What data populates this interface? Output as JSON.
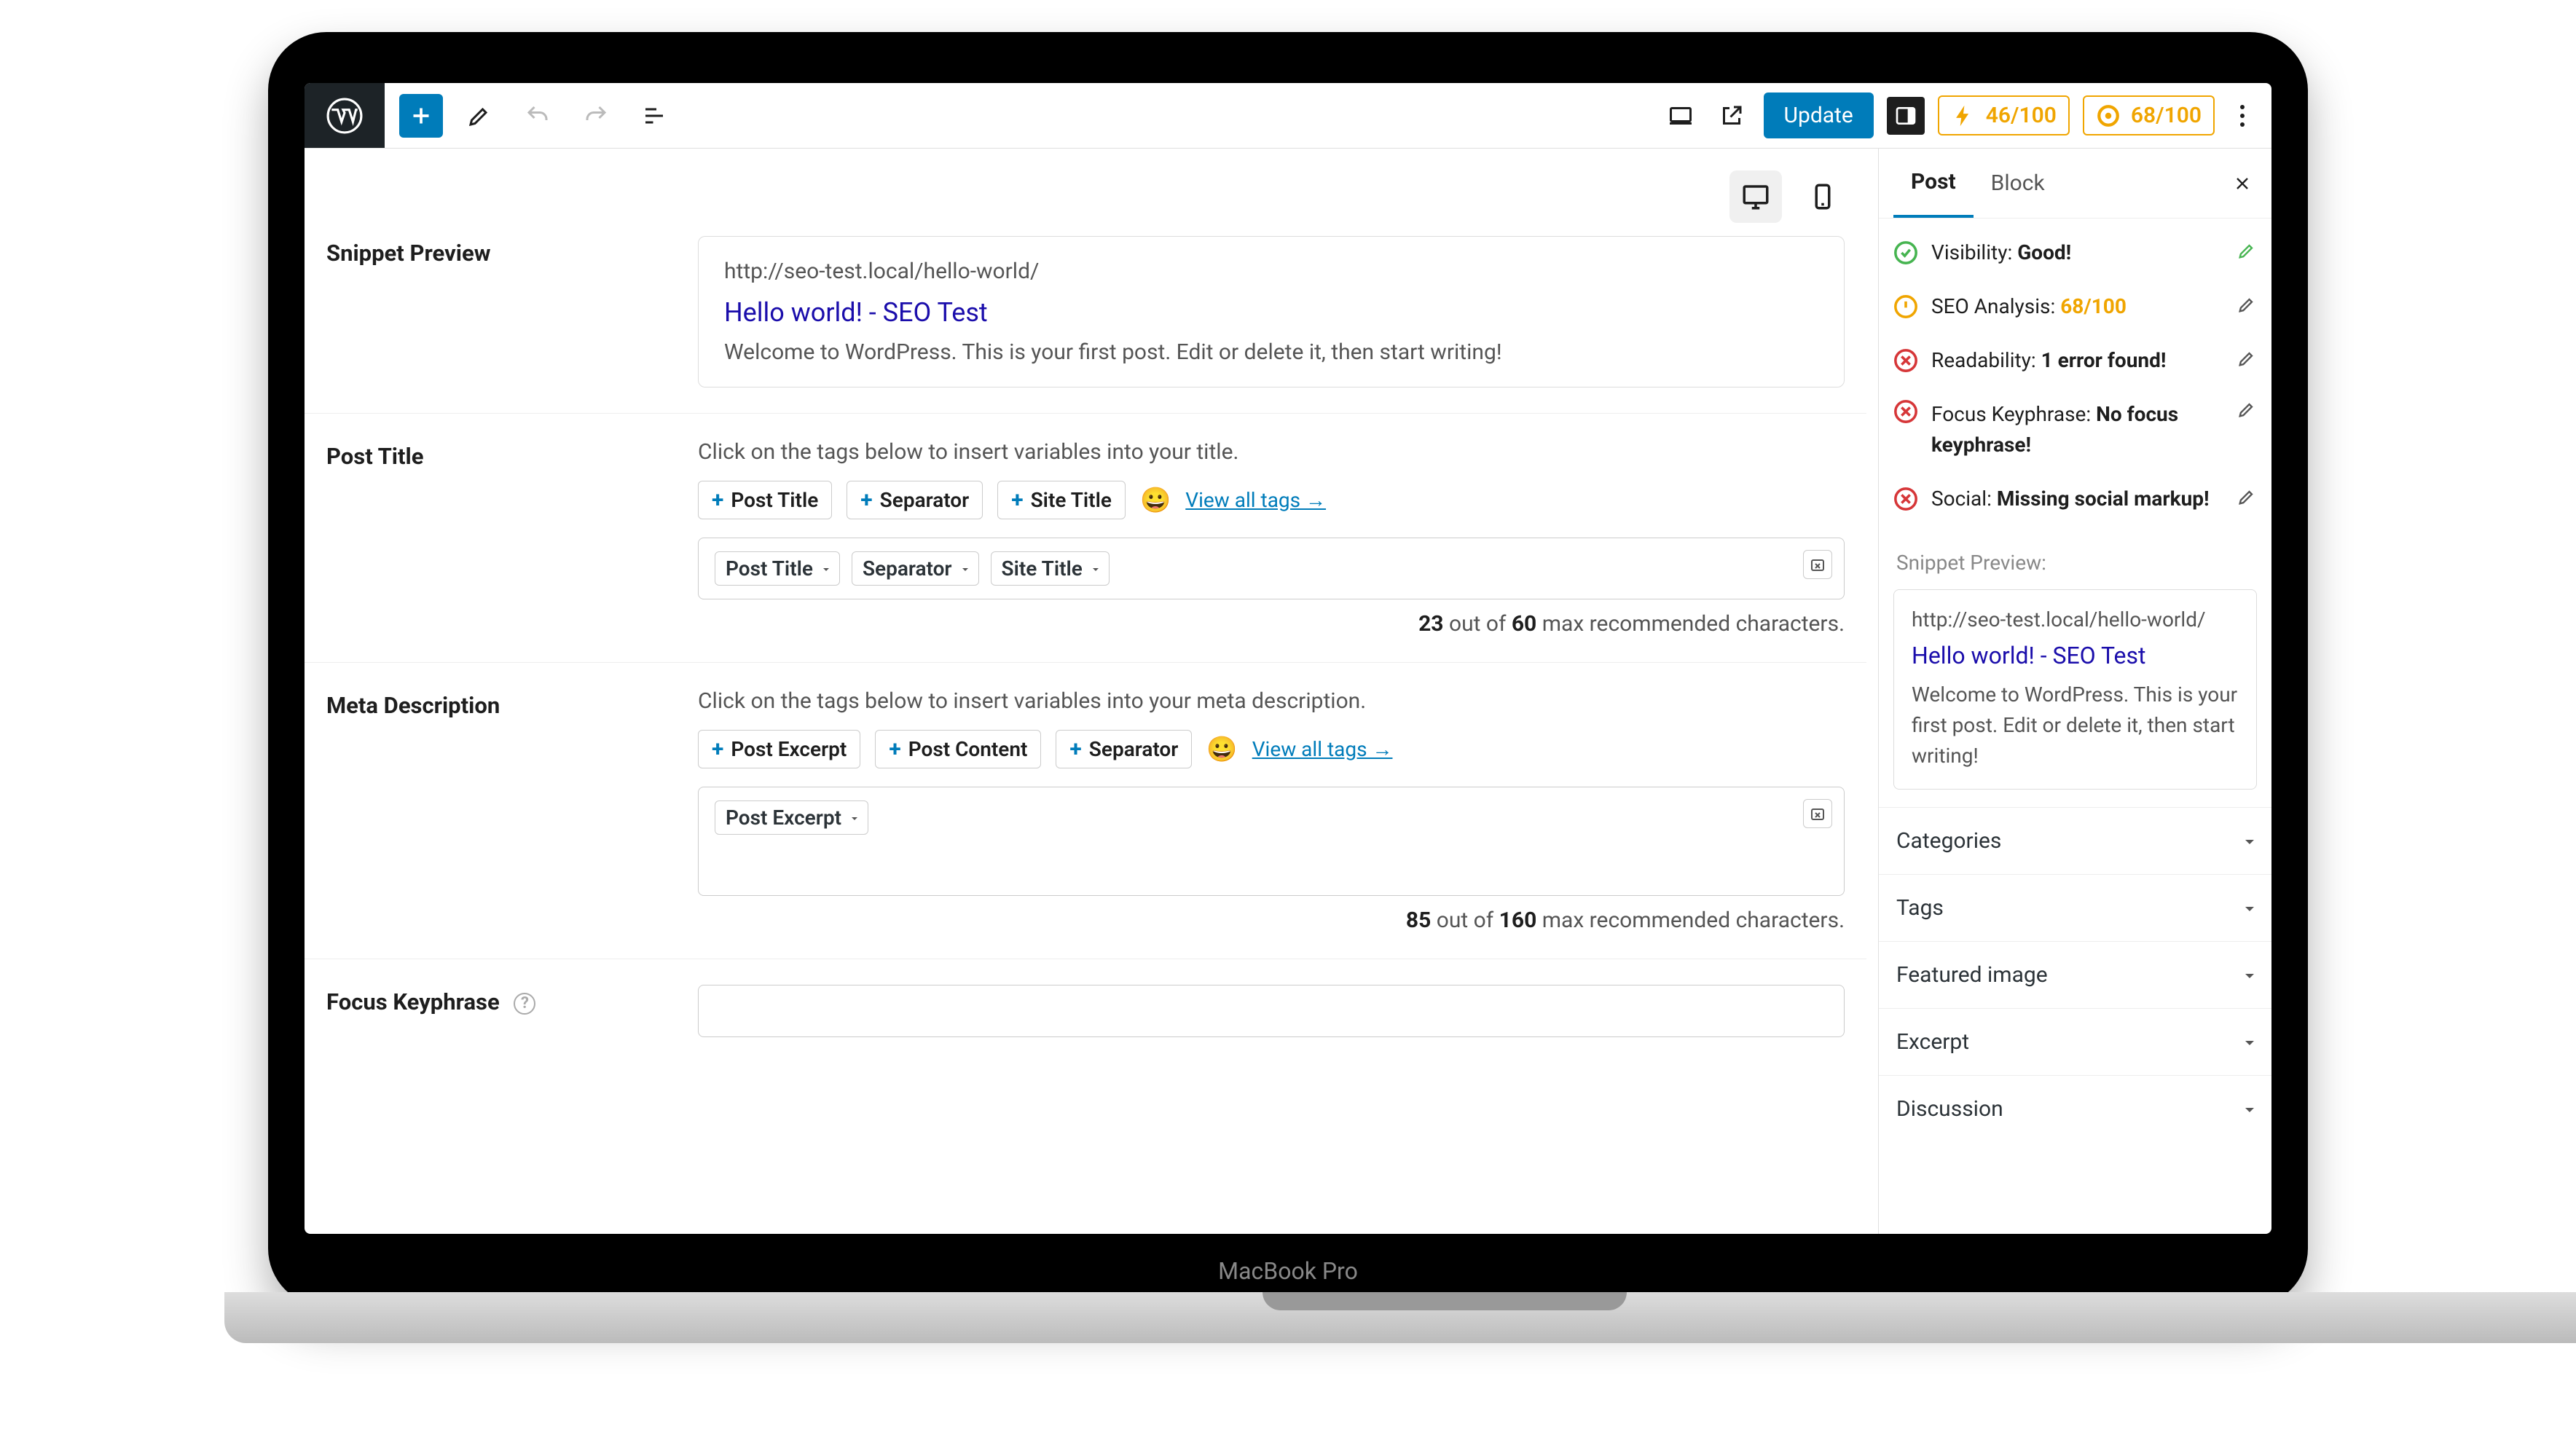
{
  "topbar": {
    "update_label": "Update",
    "score1": "46/100",
    "score2": "68/100"
  },
  "device_frame_label": "MacBook Pro",
  "snippet": {
    "url": "http://seo-test.local/hello-world/",
    "title": "Hello world! - SEO Test",
    "desc": "Welcome to WordPress. This is your first post. Edit or delete it, then start writing!"
  },
  "sections": {
    "snippet_preview_label": "Snippet Preview",
    "post_title": {
      "label": "Post Title",
      "hint": "Click on the tags below to insert variables into your title.",
      "tags": [
        "Post Title",
        "Separator",
        "Site Title"
      ],
      "view_all": "View all tags →",
      "used_tags": [
        "Post Title",
        "Separator",
        "Site Title"
      ],
      "char_used": "23",
      "char_max": "60",
      "char_text_out_of": " out of ",
      "char_text_suffix": " max recommended characters."
    },
    "meta_desc": {
      "label": "Meta Description",
      "hint": "Click on the tags below to insert variables into your meta description.",
      "tags": [
        "Post Excerpt",
        "Post Content",
        "Separator"
      ],
      "view_all": "View all tags →",
      "used_tags": [
        "Post Excerpt"
      ],
      "char_used": "85",
      "char_max": "160",
      "char_text_out_of": " out of ",
      "char_text_suffix": " max recommended characters."
    },
    "focus_keyphrase": {
      "label": "Focus Keyphrase"
    }
  },
  "sidebar": {
    "tabs": {
      "post": "Post",
      "block": "Block"
    },
    "status": {
      "visibility": {
        "label": "Visibility: ",
        "value": "Good!"
      },
      "seo": {
        "label": "SEO Analysis: ",
        "value": "68/100"
      },
      "readability": {
        "label": "Readability: ",
        "value": "1 error found!"
      },
      "keyphrase": {
        "label": "Focus Keyphrase: ",
        "value": "No focus keyphrase!"
      },
      "social": {
        "label": "Social: ",
        "value": "Missing social markup!"
      }
    },
    "snippet_preview_label": "Snippet Preview:",
    "panels": [
      "Categories",
      "Tags",
      "Featured image",
      "Excerpt",
      "Discussion"
    ]
  }
}
